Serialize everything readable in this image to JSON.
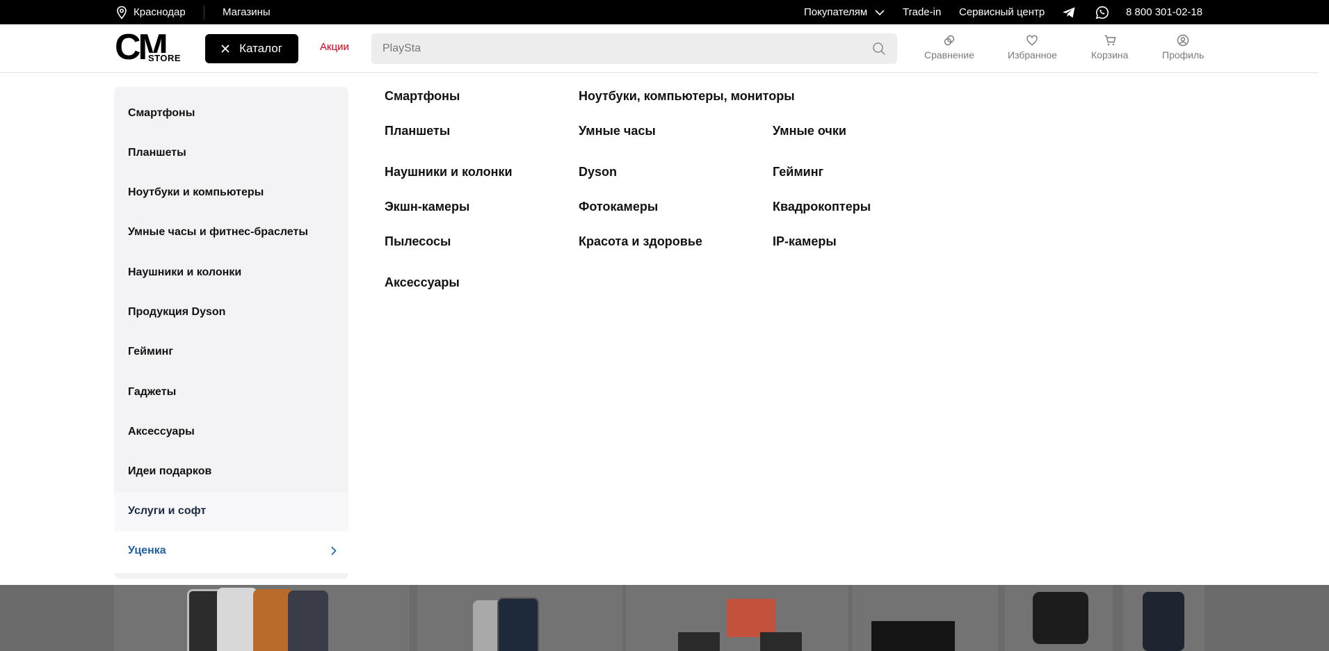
{
  "topbar": {
    "city": "Краснодар",
    "stores": "Магазины",
    "buyers": "Покупателям",
    "trade_in": "Trade-in",
    "service": "Сервисный центр",
    "phone": "8 800 301-02-18"
  },
  "header": {
    "logo_main": "CM",
    "logo_sub": "STORE",
    "catalog_label": "Каталог",
    "promo_label": "Акции",
    "search_value": "PlaySta",
    "actions": {
      "compare": "Сравнение",
      "favorites": "Избранное",
      "cart": "Корзина",
      "profile": "Профиль"
    }
  },
  "sidebar": {
    "items": [
      "Смартфоны",
      "Планшеты",
      "Ноутбуки и компьютеры",
      "Умные часы и фитнес-браслеты",
      "Наушники и колонки",
      "Продукция Dyson",
      "Гейминг",
      "Гаджеты",
      "Аксессуары",
      "Идеи подарков",
      "Услуги и софт",
      "Уценка"
    ]
  },
  "subcategories": {
    "c1": [
      "Смартфоны",
      "Планшеты",
      "Наушники и колонки",
      "Экшн-камеры",
      "Пылесосы",
      "Аксессуары"
    ],
    "c2": [
      "Ноутбуки, компьютеры, мониторы",
      "Умные часы",
      "Dyson",
      "Фотокамеры",
      "Красота и здоровье"
    ],
    "c3": [
      "Умные очки",
      "Гейминг",
      "Квадрокоптеры",
      "IP-камеры"
    ]
  },
  "colors": {
    "accent_blue": "#1f5fa8",
    "promo_red": "#d0021b",
    "topbar_bg": "#000000"
  }
}
